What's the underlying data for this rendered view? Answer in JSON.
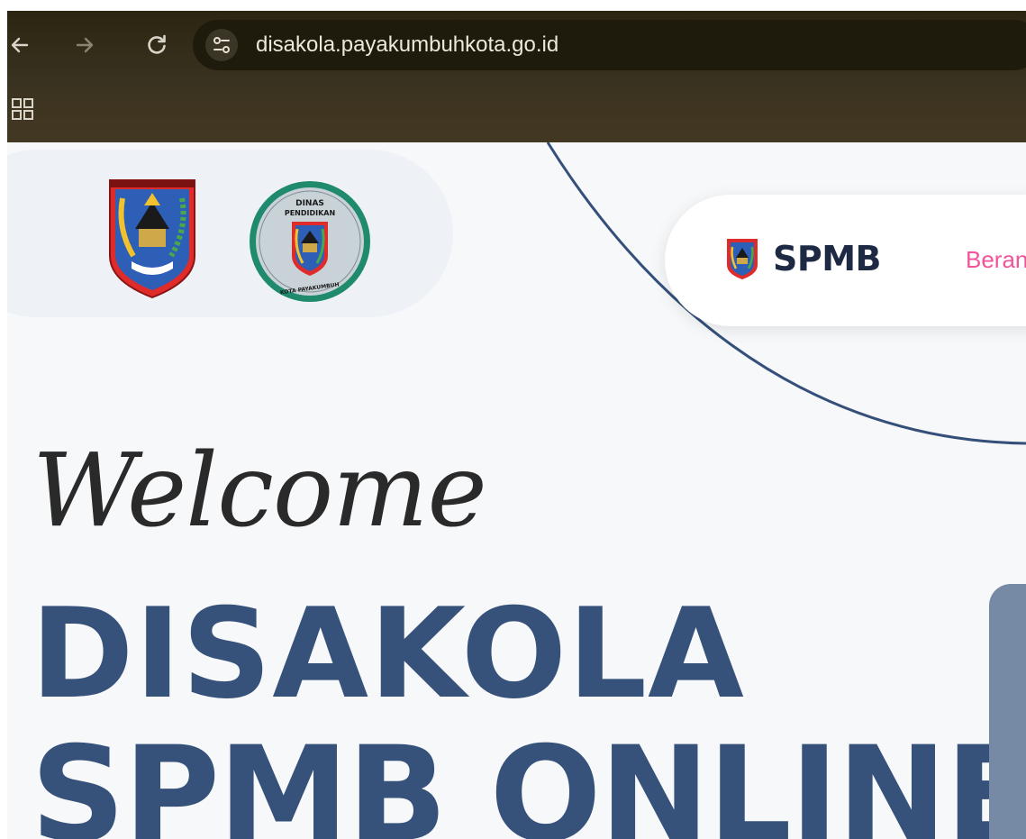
{
  "browser": {
    "url": "disakola.payakumbuhkota.go.id",
    "icons": {
      "back": "arrow-left-icon",
      "forward": "arrow-right-icon",
      "reload": "reload-icon",
      "site_info": "tune-icon",
      "apps": "apps-grid-icon"
    }
  },
  "header": {
    "logos": {
      "city_emblem": "Payakumbuh city emblem",
      "dinas_top": "DINAS",
      "dinas_middle": "PENDIDIKAN",
      "dinas_bottom": "KOTA PAYAKUMBUH"
    },
    "navbar": {
      "brand": "SPMB",
      "link_1": "Beran"
    }
  },
  "hero": {
    "welcome": "Welcome",
    "line_1": "DISAKOLA",
    "line_2": "SPMB ONLINE"
  },
  "colors": {
    "browser_bg": "#3a3220",
    "page_bg": "#f7f8fa",
    "headline": "#36517a",
    "nav_link": "#f0559c",
    "side_card": "#768aa6"
  }
}
